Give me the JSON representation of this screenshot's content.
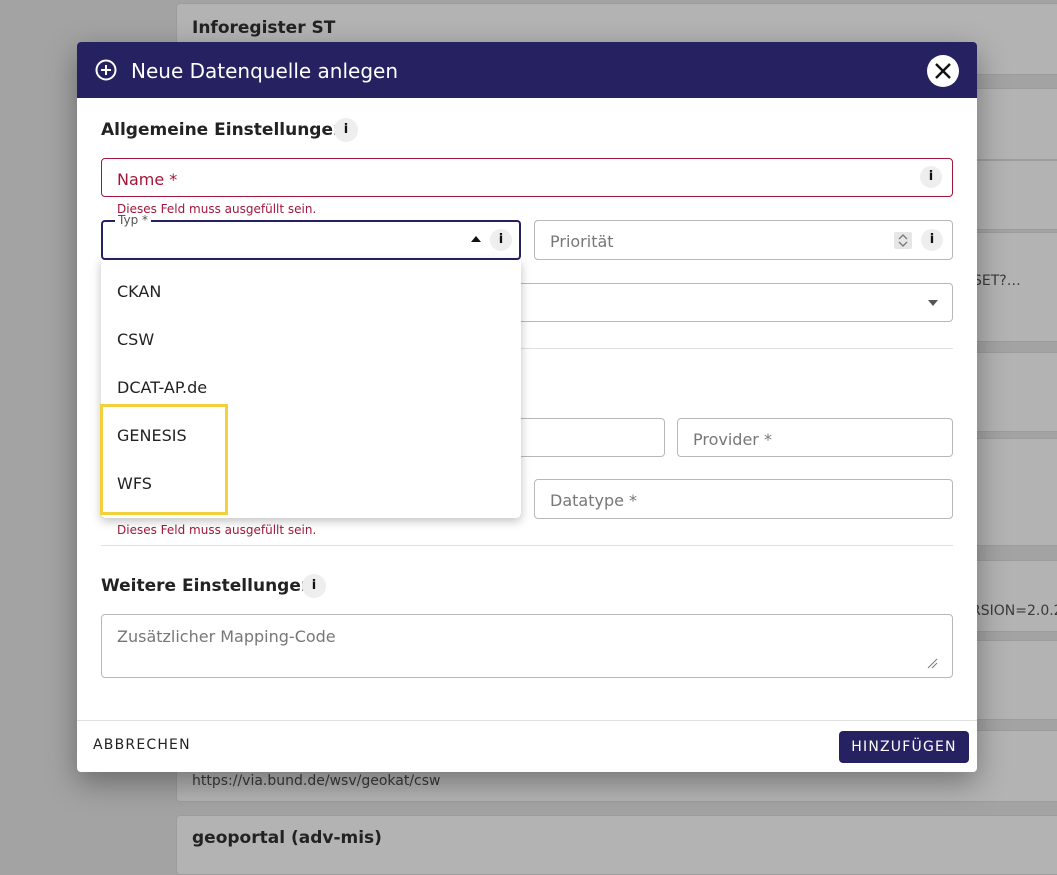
{
  "background": {
    "cards": [
      {
        "title": "Inforegister ST"
      },
      {
        "text": "SET?…"
      },
      {
        "text": "RSION=2.0.2"
      },
      {
        "text": "https://via.bund.de/wsv/geokat/csw"
      },
      {
        "title": "geoportal (adv-mis)"
      }
    ]
  },
  "dialog": {
    "title": "Neue Datenquelle anlegen",
    "general_section": "Allgemeine Einstellungen",
    "info_glyph": "i",
    "name_label": "Name *",
    "required_error": "Dieses Feld muss ausgefüllt sein.",
    "type_label": "Typ *",
    "priority_placeholder": "Priorität",
    "provider_label": "Provider *",
    "datatype_label": "Datatype *",
    "type_options": [
      "CKAN",
      "CSW",
      "DCAT-AP.de",
      "GENESIS",
      "WFS"
    ],
    "more_section": "Weitere Einstellungen",
    "mapping_placeholder": "Zusätzlicher Mapping-Code",
    "cancel_label": "ABBRECHEN",
    "add_label": "HINZUFÜGEN"
  },
  "colors": {
    "header": "#262261",
    "error": "#a0173b",
    "highlight": "#f2d13d"
  }
}
